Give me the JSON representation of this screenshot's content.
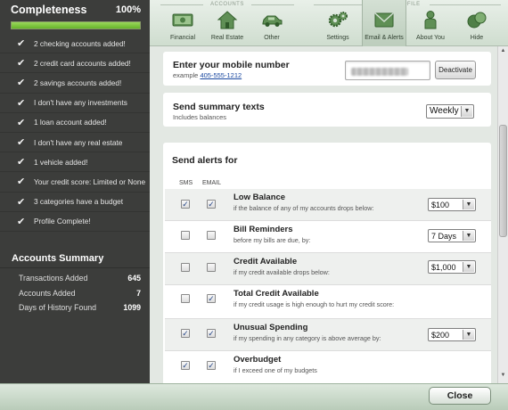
{
  "sidebar": {
    "completeness": {
      "title": "Completeness",
      "percent_label": "100%",
      "progress": 1.0
    },
    "checklist": [
      "2 checking accounts added!",
      "2 credit card accounts added!",
      "2 savings accounts added!",
      "I don't have any investments",
      "1 loan account added!",
      "I don't have any real estate",
      "1 vehicle added!",
      "Your credit score: Limited or None",
      "3 categories have a budget",
      "Profile Complete!"
    ],
    "summary": {
      "title": "Accounts Summary",
      "rows": [
        {
          "label": "Transactions Added",
          "value": "645"
        },
        {
          "label": "Accounts Added",
          "value": "7"
        },
        {
          "label": "Days of History Found",
          "value": "1099"
        }
      ]
    }
  },
  "toolbar": {
    "accounts_group_label": "ACCOUNTS",
    "profile_group_label": "PROFILE",
    "buttons": [
      {
        "label": "Financial",
        "icon": "bill-icon"
      },
      {
        "label": "Real Estate",
        "icon": "house-icon"
      },
      {
        "label": "Other",
        "icon": "car-icon"
      },
      {
        "label": "Settings",
        "icon": "gears-icon"
      },
      {
        "label": "Email & Alerts",
        "icon": "envelope-icon",
        "active": true
      },
      {
        "label": "About You",
        "icon": "person-icon"
      },
      {
        "label": "Hide",
        "icon": "hide-icon"
      }
    ]
  },
  "mobile": {
    "title": "Enter your mobile number",
    "example_prefix": "example",
    "example_number": "405-555-1212",
    "deactivate_label": "Deactivate"
  },
  "summary_texts": {
    "title": "Send summary texts",
    "subtitle": "Includes balances",
    "frequency": "Weekly"
  },
  "alerts": {
    "title": "Send alerts for",
    "sms_label": "SMS",
    "email_label": "EMAIL",
    "items": [
      {
        "title": "Low Balance",
        "desc": "if the balance of any of my accounts drops below:",
        "sms": true,
        "email": true,
        "select": "$100"
      },
      {
        "title": "Bill Reminders",
        "desc": "before my bills are due, by:",
        "sms": false,
        "email": false,
        "select": "7 Days"
      },
      {
        "title": "Credit Available",
        "desc": "if my credit available drops below:",
        "sms": false,
        "email": false,
        "select": "$1,000"
      },
      {
        "title": "Total Credit Available",
        "desc": "if my credit usage is high enough to hurt my credit score:",
        "sms": false,
        "email": true,
        "select": ""
      },
      {
        "title": "Unusual Spending",
        "desc": "if my spending in any category is above average by:",
        "sms": true,
        "email": true,
        "select": "$200"
      },
      {
        "title": "Overbudget",
        "desc": "if I exceed one of my budgets",
        "sms": true,
        "email": true,
        "select": ""
      }
    ]
  },
  "footer": {
    "close_label": "Close"
  },
  "colors": {
    "sidebar_bg": "#3c3d3b",
    "progress_green": "#7ac143",
    "link_blue": "#1a48a0",
    "toolbar_green": "#d8e4d8"
  }
}
